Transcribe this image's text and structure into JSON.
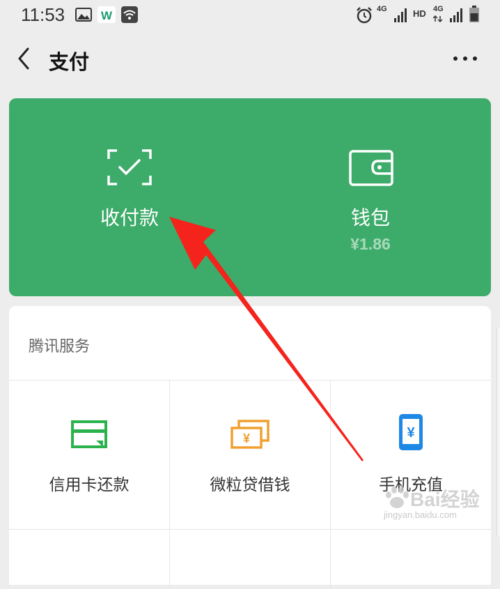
{
  "status_bar": {
    "time": "11:53",
    "icons": [
      "image-icon",
      "app-w-icon",
      "wifi-icon",
      "alarm-icon",
      "signal-4g-icon",
      "hd-icon",
      "signal-4g-2-icon",
      "battery-icon"
    ],
    "labels": {
      "net1": "4G",
      "hd": "HD",
      "net2": "4G"
    }
  },
  "nav": {
    "title": "支付",
    "back_icon": "chevron-left-icon",
    "more_icon": "more-dots-icon"
  },
  "pay_card": {
    "background": "#3dab69",
    "collect": {
      "label": "收付款",
      "icon": "scan-check-icon"
    },
    "wallet": {
      "label": "钱包",
      "balance": "¥1.86",
      "icon": "wallet-icon"
    }
  },
  "services": {
    "title": "腾讯服务",
    "items": [
      {
        "label": "信用卡还款",
        "icon": "credit-card-icon",
        "color": "#2bb24c"
      },
      {
        "label": "微粒贷借钱",
        "icon": "cash-stack-icon",
        "color": "#f0a030"
      },
      {
        "label": "手机充值",
        "icon": "phone-yuan-icon",
        "color": "#1e88e5"
      }
    ]
  },
  "annotation": {
    "arrow_color": "#f4241d"
  },
  "watermark": {
    "brand": "Bai经验",
    "url": "jingyan.baidu.com"
  }
}
